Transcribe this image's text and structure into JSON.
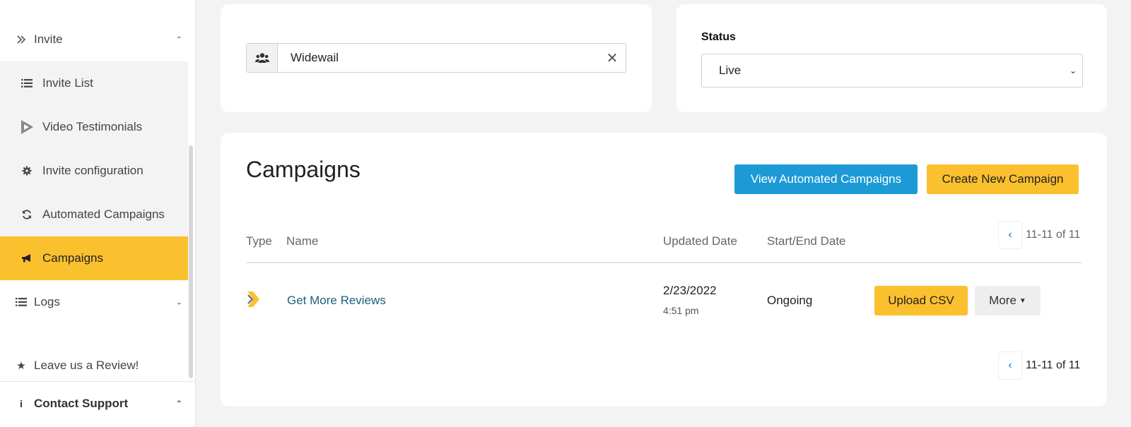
{
  "sidebar": {
    "items": [
      {
        "label": "Invite",
        "icon": "double-chevron-right-icon"
      },
      {
        "label": "Invite List",
        "icon": "list-icon"
      },
      {
        "label": "Video Testimonials",
        "icon": "play-icon"
      },
      {
        "label": "Invite configuration",
        "icon": "gear-icon"
      },
      {
        "label": "Automated Campaigns",
        "icon": "refresh-icon"
      },
      {
        "label": "Campaigns",
        "icon": "megaphone-icon",
        "active": true
      },
      {
        "label": "Logs",
        "icon": "list-icon"
      },
      {
        "label": "Leave us a Review!",
        "icon": "star-icon"
      },
      {
        "label": "Contact Support",
        "icon": "info-icon"
      }
    ]
  },
  "filter": {
    "search_value": "Widewail",
    "clear_symbol": "✕"
  },
  "status": {
    "label": "Status",
    "selected": "Live"
  },
  "campaigns": {
    "title": "Campaigns",
    "view_automated_label": "View Automated Campaigns",
    "create_new_label": "Create New Campaign",
    "columns": {
      "type": "Type",
      "name": "Name",
      "updated": "Updated Date",
      "start_end": "Start/End Date"
    },
    "pager_text": "11-11 of 11",
    "rows": [
      {
        "name": "Get More Reviews",
        "updated_date": "2/23/2022",
        "updated_time": "4:51 pm",
        "start_end": "Ongoing",
        "upload_label": "Upload CSV",
        "more_label": "More"
      }
    ]
  },
  "colors": {
    "accent_yellow": "#fbc02d",
    "accent_blue": "#1c9ad6",
    "link": "#1f5e7f"
  }
}
